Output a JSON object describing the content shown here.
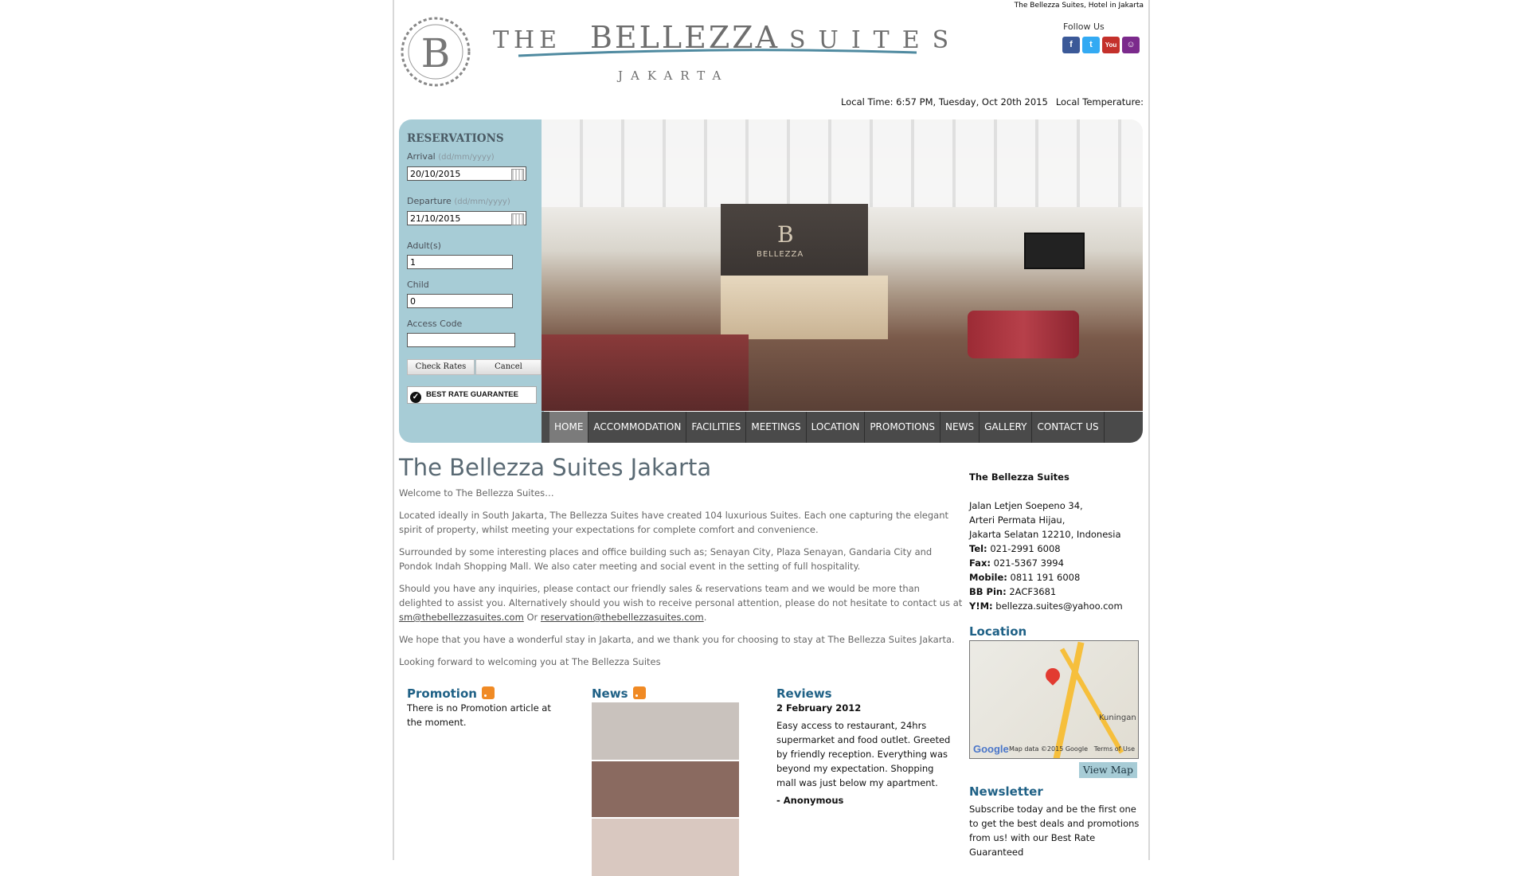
{
  "header": {
    "topline": "The Bellezza Suites, Hotel in Jakarta",
    "logo_the": "THE",
    "logo_bellezza": "BELLEZZA",
    "logo_suites": "SUITES",
    "logo_city": "JAKARTA",
    "logo_monogram": "B",
    "follow_us": "Follow Us",
    "social": [
      "f",
      "t",
      "You",
      "☺"
    ],
    "local_time": "Local Time: 6:57 PM, Tuesday, Oct 20th 2015",
    "local_temp": "Local Temperature:"
  },
  "reservations": {
    "title": "RESERVATIONS",
    "arrival_label": "Arrival",
    "arrival_hint": "(dd/mm/yyyy)",
    "arrival_value": "20/10/2015",
    "departure_label": "Departure",
    "departure_hint": "(dd/mm/yyyy)",
    "departure_value": "21/10/2015",
    "adults_label": "Adult(s)",
    "adults_value": "1",
    "child_label": "Child",
    "child_value": "0",
    "access_label": "Access Code",
    "access_value": "",
    "check_rates": "Check Rates",
    "cancel": "Cancel",
    "best_rate": "BEST RATE GUARANTEE"
  },
  "hero": {
    "desk_monogram": "B",
    "desk_text": "BELLEZZA"
  },
  "nav": [
    "HOME",
    "ACCOMMODATION",
    "FACILITIES",
    "MEETINGS",
    "LOCATION",
    "PROMOTIONS",
    "NEWS",
    "GALLERY",
    "CONTACT US"
  ],
  "main": {
    "title": "The Bellezza Suites Jakarta",
    "welcome": "Welcome to The Bellezza Suites…",
    "p1": "Located ideally in South Jakarta, The Bellezza Suites have created 104 luxurious Suites. Each one capturing the elegant spirit of property, whilst meeting your expectations for complete comfort and convenience.",
    "p2": "Surrounded by some interesting places and office building such as; Senayan City, Plaza Senayan, Gandaria City and Pondok Indah Shopping Mall. We also cater meeting and social event in the setting of full hospitality.",
    "p3a": "Should you have any inquiries, please contact our friendly sales & reservations team and we would be more than delighted to assist you. Alternatively should you wish to receive personal attention, please do not hesitate to contact us at",
    "email1": "sm@thebellezzasuites.com",
    "p3or": "Or",
    "email2": "reservation@thebellezzasuites.com",
    "p4": "We hope that you have a wonderful stay in Jakarta, and we thank you for choosing to stay at The Bellezza Suites Jakarta.",
    "p5": "Looking forward to welcoming you at The Bellezza Suites"
  },
  "promotion": {
    "title": "Promotion",
    "text": "There is no Promotion article at the moment."
  },
  "news": {
    "title": "News"
  },
  "reviews": {
    "title": "Reviews",
    "date": "2 February 2012",
    "text": "Easy access to restaurant, 24hrs supermarket and food outlet. Greeted by friendly reception. Everything was beyond my expectation. Shopping mall was just below my apartment.",
    "author": "- Anonymous"
  },
  "contact": {
    "name": "The Bellezza Suites",
    "addr1": "Jalan Letjen Soepeno 34,",
    "addr2": "Arteri Permata Hijau,",
    "addr3": "Jakarta Selatan 12210, Indonesia",
    "tel_label": "Tel:",
    "tel": "021-2991 6008",
    "fax_label": "Fax:",
    "fax": "021-5367 3994",
    "mobile_label": "Mobile:",
    "mobile": "0811 191 6008",
    "bb_label": "BB Pin:",
    "bb": "2ACF3681",
    "ym_label": "Y!M:",
    "ym": "bellezza.suites@yahoo.com"
  },
  "location": {
    "title": "Location",
    "map_place": "Kuningan",
    "map_data": "Map data ©2015 Google",
    "terms": "Terms of Use",
    "google": "Google",
    "view_map": "View Map"
  },
  "newsletter": {
    "title": "Newsletter",
    "text": "Subscribe today and be the first one to get the best deals and promotions from us! with our Best Rate Guaranteed"
  },
  "colors": {
    "accent": "#a7ccd6",
    "heading": "#1f6186",
    "nav_bg": "#4a4a4a"
  }
}
